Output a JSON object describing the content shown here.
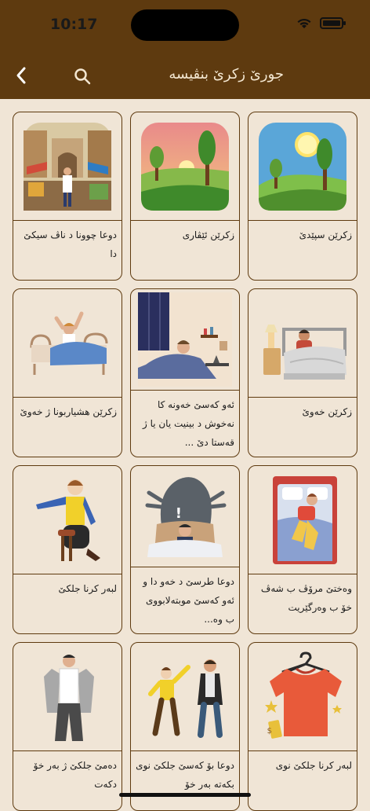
{
  "status": {
    "time": "10:17"
  },
  "header": {
    "title": "جورێ زکرێ بنڤیسە"
  },
  "cards": [
    {
      "label": "زکرێن سپێدێ",
      "icon": "sunny-landscape-icon"
    },
    {
      "label": "زکرێن ئێڤاری",
      "icon": "sunset-landscape-icon"
    },
    {
      "label": "دوعا چوونا د ناڤ سیکێ دا",
      "icon": "market-street-icon"
    },
    {
      "label": "زکرێن خەوێ",
      "icon": "person-in-bed-icon"
    },
    {
      "label": "ئەو کەسێ خەونە کا نەخوش د بینیت یان یا ژ قەستا دێ ...",
      "icon": "nightmare-bedroom-icon"
    },
    {
      "label": "زکرێن هشیاربونا ژ خەوێ",
      "icon": "waking-up-icon"
    },
    {
      "label": "وەختێ مرۆڤ ب شەڤ خۆ ب وەرگێریت",
      "icon": "turning-in-bed-icon"
    },
    {
      "label": "دوعا طرسێ د خەو دا و ئەو کەسێ موبتەلابووی ب وە...",
      "icon": "scary-dream-icon"
    },
    {
      "label": "لبەر کرنا جلکێ",
      "icon": "putting-on-clothes-icon"
    },
    {
      "label": "لبەر کرنا جلکێ نوی",
      "icon": "new-shirt-icon"
    },
    {
      "label": "دوعا بۆ کەسێ جلکێ نوی بکەتە بەر خۆ",
      "icon": "compliment-clothes-icon"
    },
    {
      "label": "دەمێ جلکێ ژ بەر خۆ دکەت",
      "icon": "taking-off-clothes-icon"
    }
  ],
  "colors": {
    "brand": "#5e3a0f",
    "background": "#f0e5d6",
    "border": "#5e3a0f"
  }
}
